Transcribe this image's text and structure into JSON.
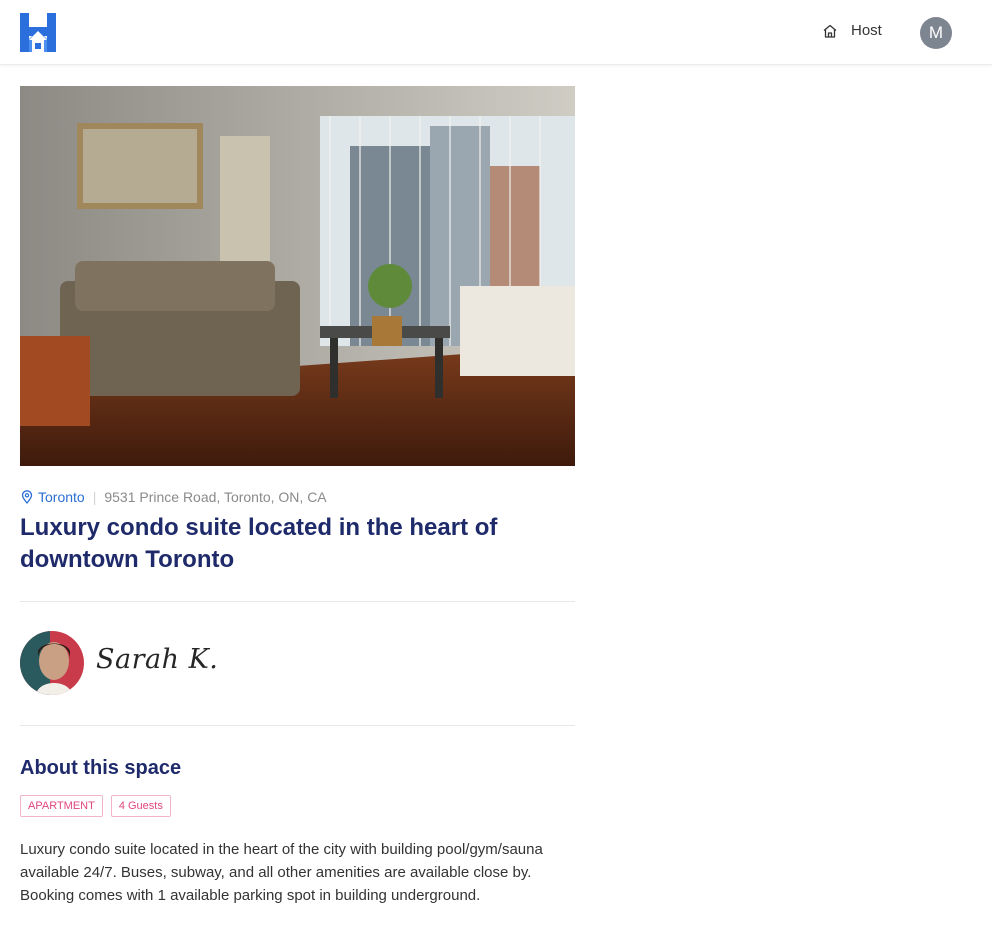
{
  "nav": {
    "logo_icon": "house-logo-icon",
    "host_label": "Host",
    "host_icon": "home-outline-icon",
    "user_initial": "M"
  },
  "listing": {
    "photo_alt": "living-room-photo",
    "city": "Toronto",
    "address": "9531 Prince Road, Toronto, ON, CA",
    "title": "Luxury condo suite located in the heart of downtown Toronto",
    "host_name": "Sarah K.",
    "about_heading": "About this space",
    "badges": [
      "APARTMENT",
      "4 Guests"
    ],
    "description": "Luxury condo suite located in the heart of the city with building pool/gym/sauna available 24/7. Buses, subway, and all other amenities are available close by. Booking comes with 1 available parking spot in building underground."
  },
  "colors": {
    "brand_blue": "#2a6fdb",
    "title_navy": "#1f2a6b",
    "badge_pink": "#e0457d",
    "avatar_gray": "#7d8590"
  }
}
